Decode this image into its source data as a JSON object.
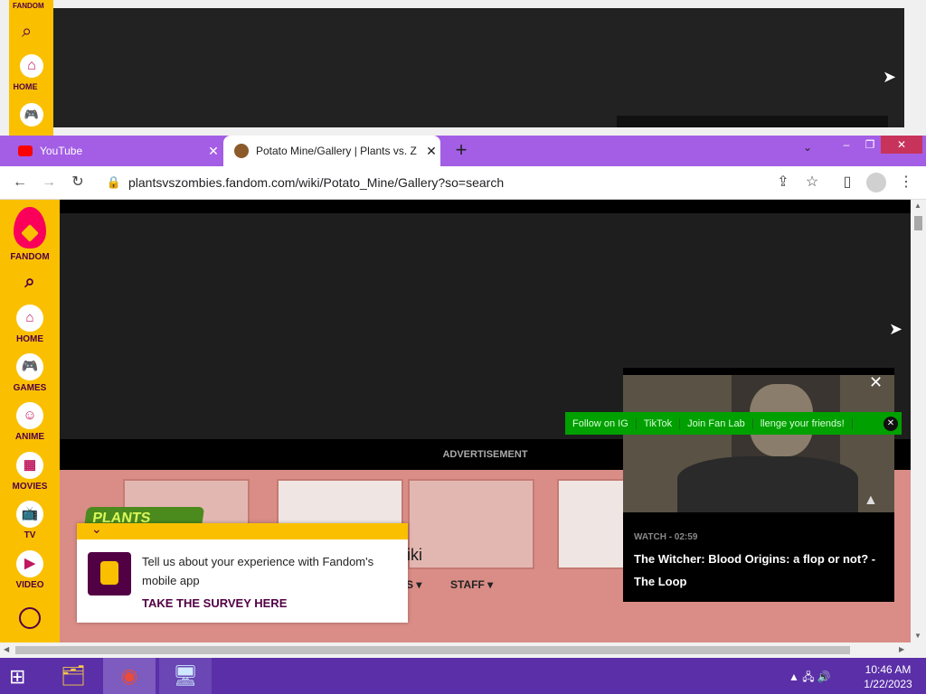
{
  "background_window": {
    "rail_items": [
      {
        "icon": "search-icon"
      },
      {
        "icon": "home-icon",
        "label": "HOME"
      },
      {
        "icon": "games-icon"
      }
    ],
    "rail_top_label": "FANDOM"
  },
  "browser": {
    "tabs": [
      {
        "title": "YouTube",
        "icon": "youtube-icon",
        "active": false
      },
      {
        "title": "Potato Mine/Gallery | Plants vs. Z",
        "icon": "potato-mine-icon",
        "active": true
      }
    ],
    "url": "plantsvszombies.fandom.com/wiki/Potato_Mine/Gallery?so=search",
    "new_tab_glyph": "+",
    "tab_close_glyph": "✕",
    "dropdown_glyph": "⌄",
    "window_controls": {
      "minimize": "–",
      "restore": "❐",
      "close": "✕"
    }
  },
  "fandom_rail": {
    "logo_label": "FANDOM",
    "items": [
      {
        "icon": "home-icon",
        "label": "HOME",
        "glyph": "⌂"
      },
      {
        "icon": "games-icon",
        "label": "GAMES",
        "glyph": "🎮"
      },
      {
        "icon": "anime-icon",
        "label": "ANIME",
        "glyph": "☺"
      },
      {
        "icon": "movies-icon",
        "label": "MOVIES",
        "glyph": "▦"
      },
      {
        "icon": "tv-icon",
        "label": "TV",
        "glyph": "📺"
      },
      {
        "icon": "video-icon",
        "label": "VIDEO",
        "glyph": "▶"
      }
    ],
    "account_icon": "user-icon"
  },
  "page": {
    "advertisement_label": "ADVERTISEMENT",
    "wiki_suffix": "iki",
    "nav_partial": "S ▾",
    "staff_link": "STAFF ▾",
    "logo_text": "PLANTS"
  },
  "survey": {
    "message": "Tell us about your experience with Fandom's mobile app",
    "cta": "TAKE THE SURVEY HERE"
  },
  "video": {
    "meta": "WATCH - 02:59",
    "title": "The Witcher: Blood Origins: a flop or not? - The Loop",
    "close_glyph": "✕"
  },
  "social_bar": {
    "items": [
      "Follow on IG",
      "TikTok",
      "Join Fan Lab",
      "llenge your friends!"
    ],
    "close_glyph": "✕"
  },
  "taskbar": {
    "time": "10:46 AM",
    "date": "1/22/2023"
  }
}
